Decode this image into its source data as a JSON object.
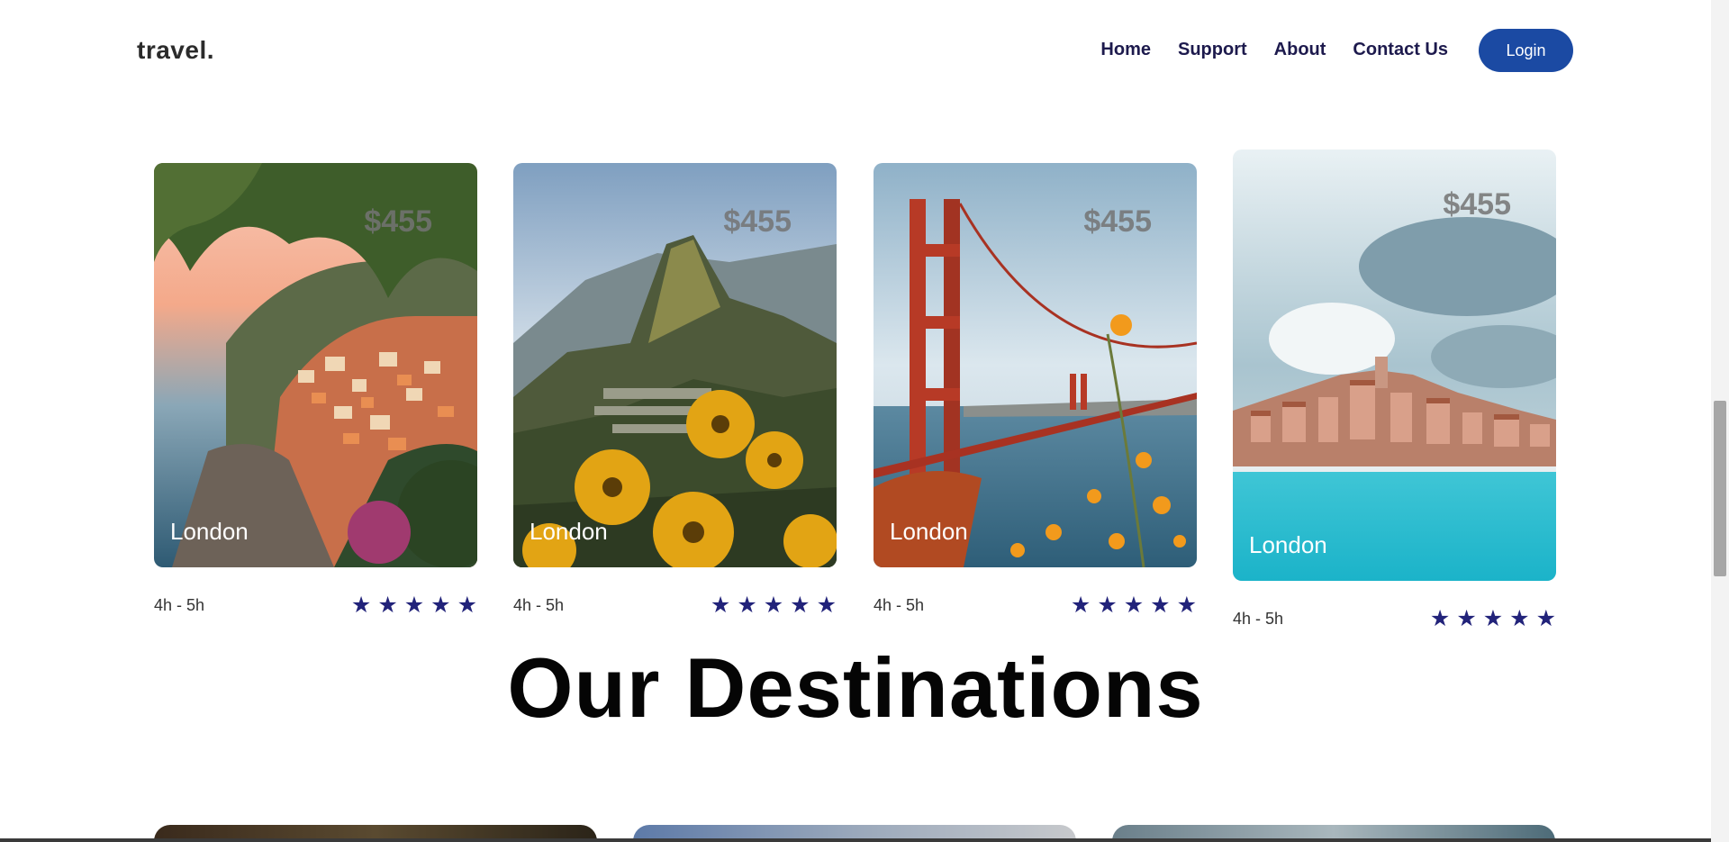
{
  "nav": {
    "logo": "travel.",
    "links": [
      "Home",
      "Support",
      "About",
      "Contact Us"
    ],
    "login_label": "Login"
  },
  "cards": [
    {
      "price": "$455",
      "city": "London",
      "duration": "4h - 5h",
      "rating": 5
    },
    {
      "price": "$455",
      "city": "London",
      "duration": "4h - 5h",
      "rating": 5
    },
    {
      "price": "$455",
      "city": "London",
      "duration": "4h - 5h",
      "rating": 5
    },
    {
      "price": "$455",
      "city": "London",
      "duration": "4h - 5h",
      "rating": 5
    }
  ],
  "section_heading": "Our Destinations",
  "colors": {
    "accent": "#1b4aa3",
    "nav_text": "#1d1a4d",
    "star": "#22237a"
  },
  "icons": {
    "star": "star-icon"
  }
}
